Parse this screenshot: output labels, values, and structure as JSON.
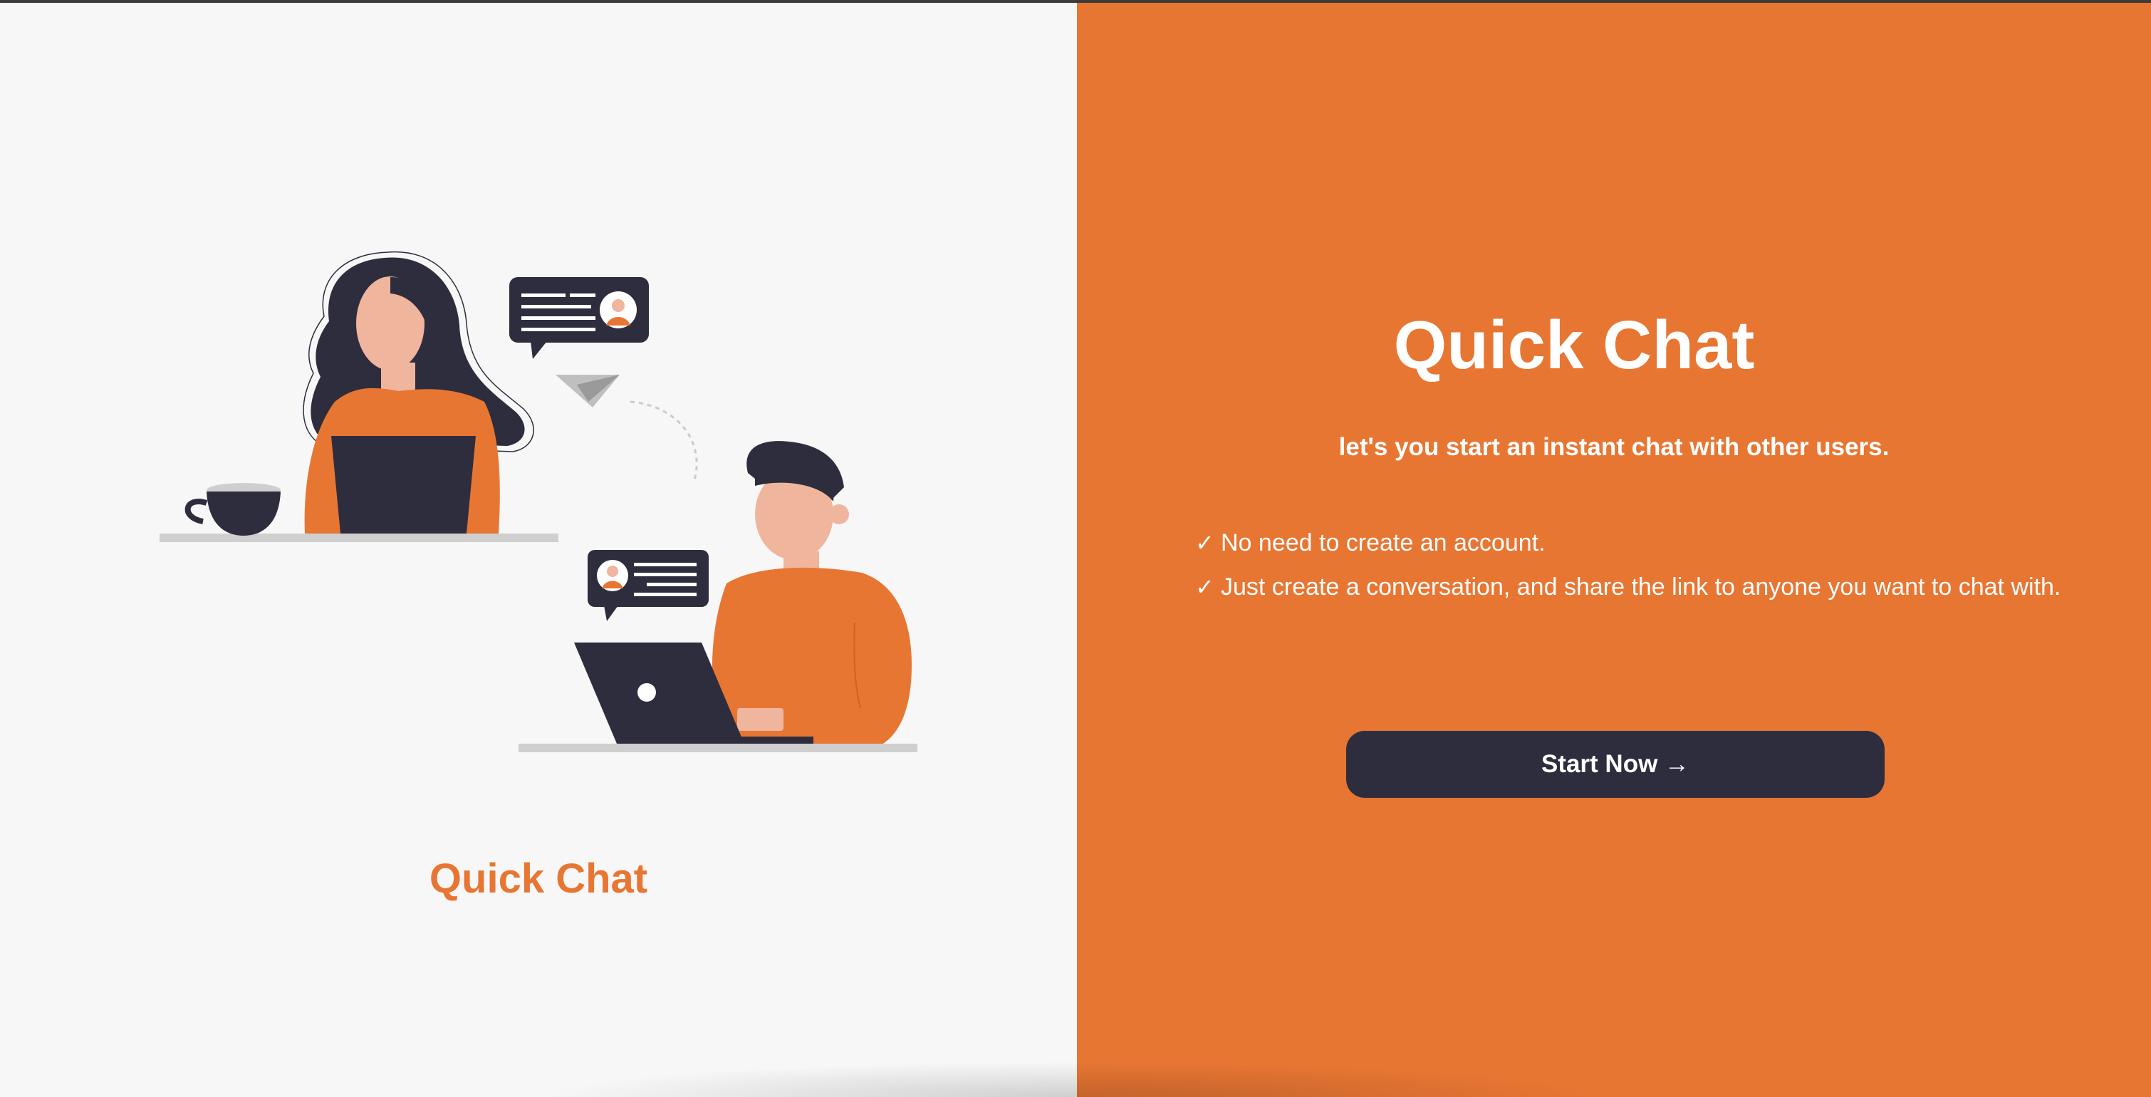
{
  "brand": {
    "name": "Quick Chat"
  },
  "hero": {
    "title": "Quick Chat",
    "tagline": "let's you start an instant chat with other users.",
    "features": [
      {
        "check": "✓",
        "text": "No need to create an account."
      },
      {
        "check": "✓",
        "text": "Just create a conversation, and share the link to anyone you want to chat with."
      }
    ],
    "cta_label": "Start Now →"
  },
  "illustration": {
    "name": "two-people-chatting-illustration"
  },
  "colors": {
    "accent": "#e87633",
    "dark": "#2e2d3e",
    "light_bg": "#f7f7f7",
    "skin": "#f0b59d"
  }
}
